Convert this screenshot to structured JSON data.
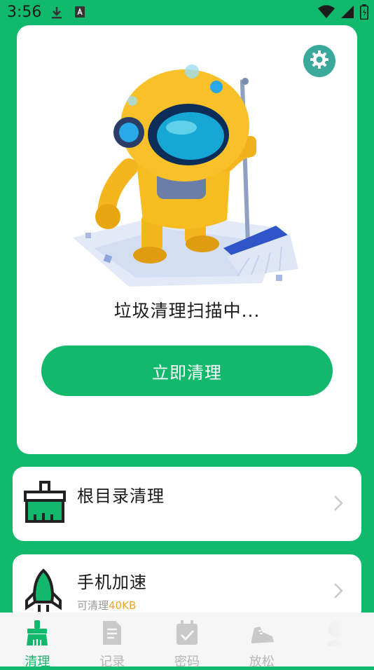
{
  "status_bar": {
    "time": "3:56"
  },
  "hero": {
    "scan_status": "垃圾清理扫描中...",
    "clean_button": "立即清理"
  },
  "features": [
    {
      "title": "根目录清理",
      "subtitle_prefix": "",
      "subtitle_amount": ""
    },
    {
      "title": "手机加速",
      "subtitle_prefix": "可清理",
      "subtitle_amount": "40KB"
    }
  ],
  "nav": {
    "items": [
      {
        "label": "清理",
        "icon": "broom-icon"
      },
      {
        "label": "记录",
        "icon": "document-icon"
      },
      {
        "label": "密码",
        "icon": "calendar-check-icon"
      },
      {
        "label": "放松",
        "icon": "sneaker-icon"
      }
    ]
  },
  "colors": {
    "brand_green": "#10b96b",
    "accent_amount": "#f2a623"
  }
}
